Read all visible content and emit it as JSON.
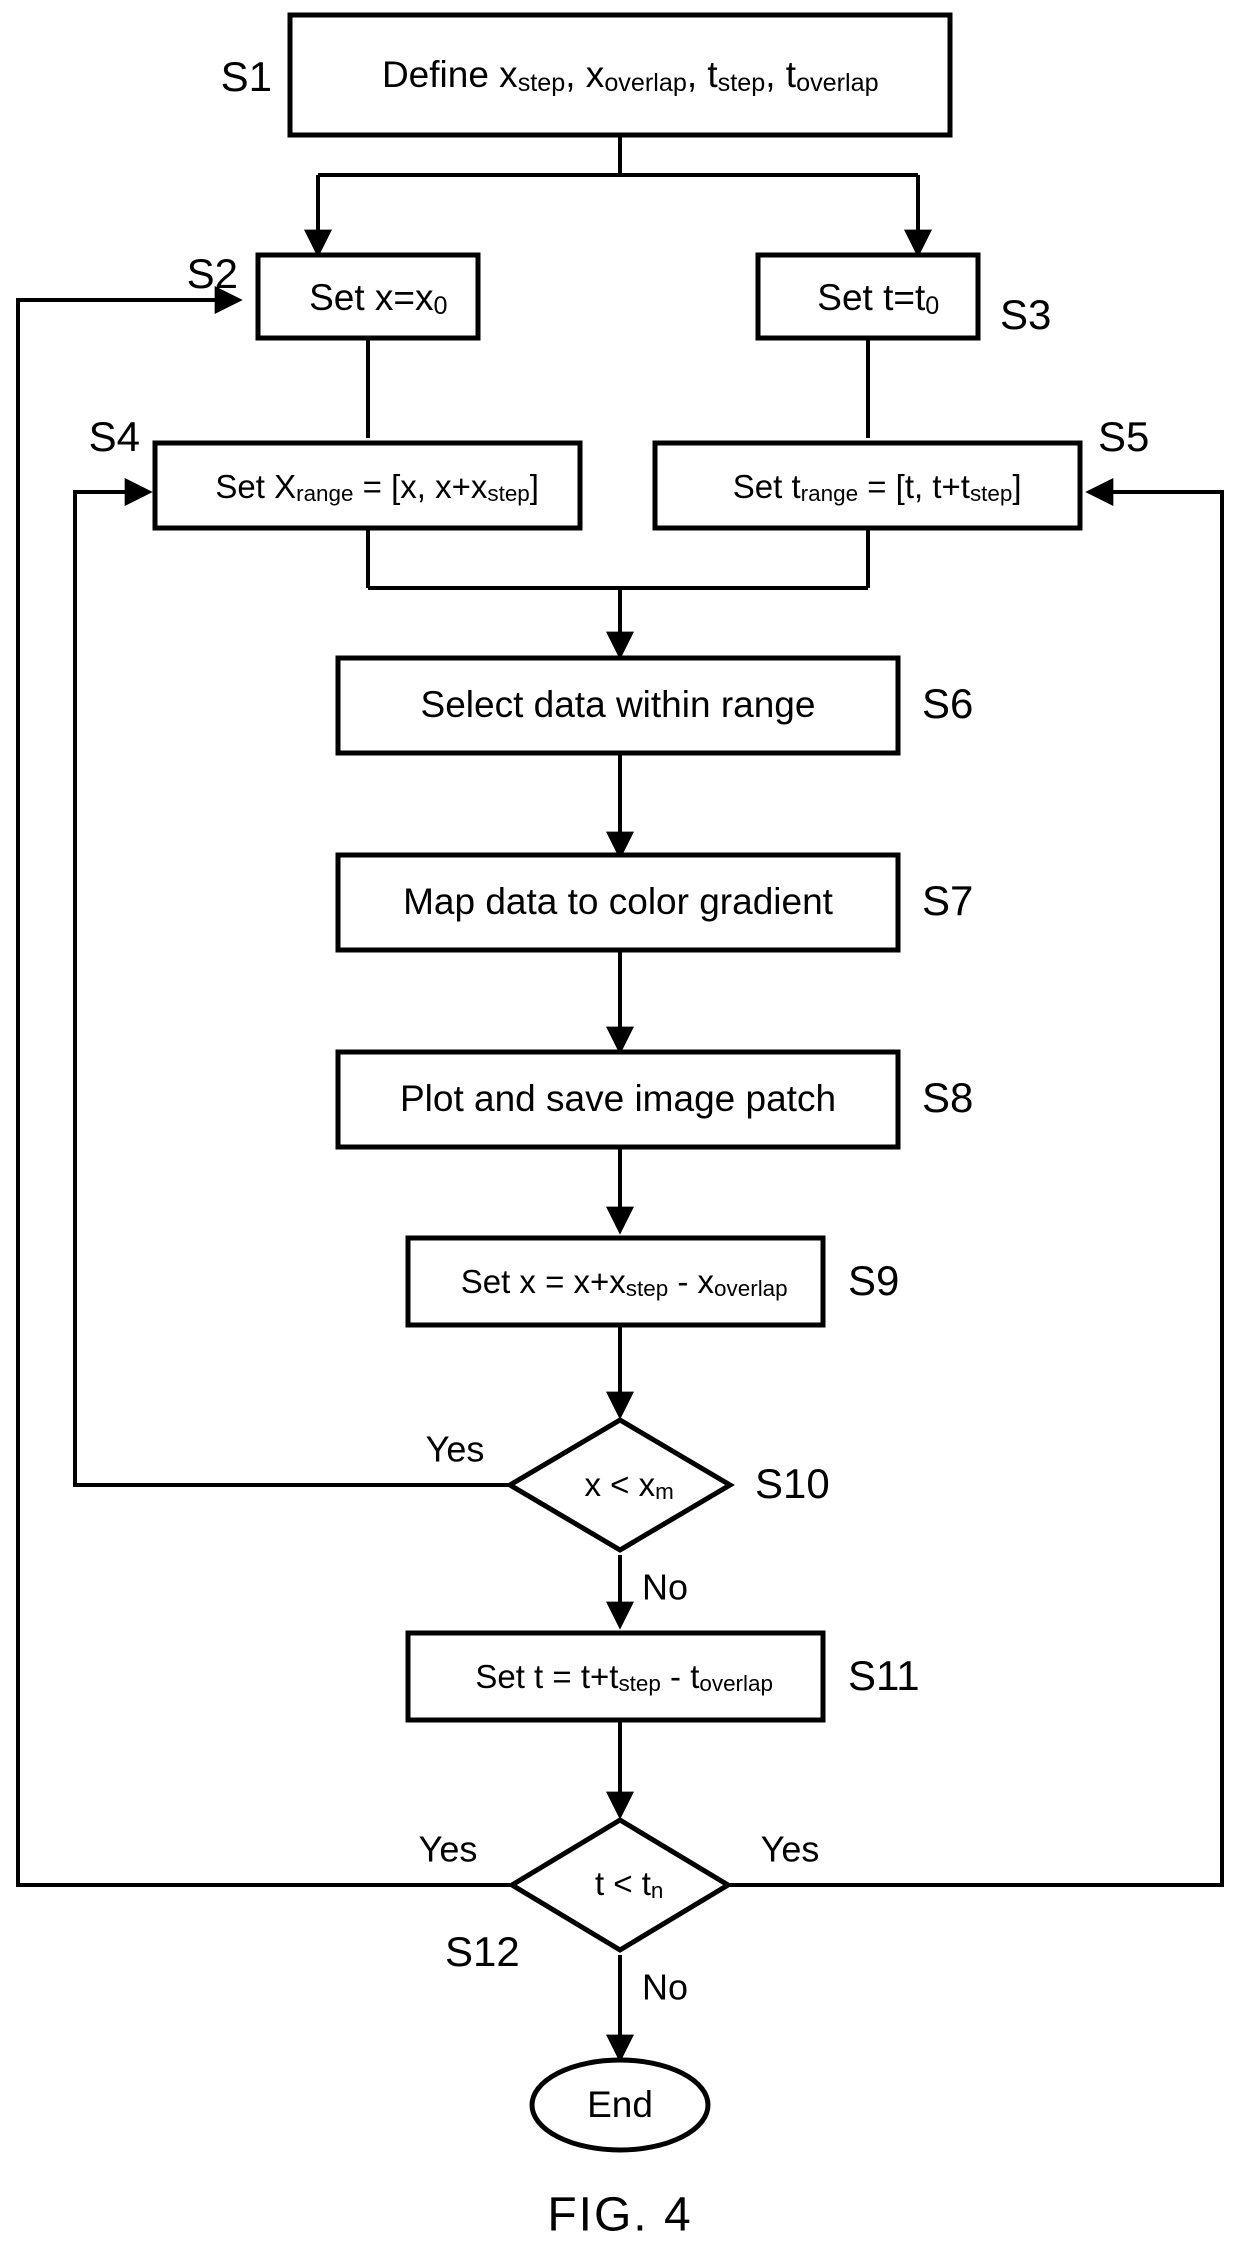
{
  "figure": {
    "caption": "FIG. 4",
    "type": "flowchart"
  },
  "nodes": {
    "s1": {
      "tag": "S1",
      "shape": "process",
      "text_parts": [
        "Define x",
        "step",
        ", x",
        "overlap",
        ", t",
        "step",
        ", t",
        "overlap"
      ],
      "text_plain": "Define x_step, x_overlap, t_step, t_overlap"
    },
    "s2": {
      "tag": "S2",
      "shape": "process",
      "text_parts": [
        "Set x=x",
        "0"
      ],
      "text_plain": "Set x=x_0"
    },
    "s3": {
      "tag": "S3",
      "shape": "process",
      "text_parts": [
        "Set t=t",
        "0"
      ],
      "text_plain": "Set t=t_0"
    },
    "s4": {
      "tag": "S4",
      "shape": "process",
      "text_parts": [
        "Set X",
        "range",
        " = [x, x+x",
        "step",
        "]"
      ],
      "text_plain": "Set X_range = [x, x+x_step]"
    },
    "s5": {
      "tag": "S5",
      "shape": "process",
      "text_parts": [
        "Set t",
        "range",
        " = [t, t+t",
        "step",
        "]"
      ],
      "text_plain": "Set t_range = [t, t+t_step]"
    },
    "s6": {
      "tag": "S6",
      "shape": "process",
      "text_plain": "Select data within range"
    },
    "s7": {
      "tag": "S7",
      "shape": "process",
      "text_plain": "Map data to color gradient"
    },
    "s8": {
      "tag": "S8",
      "shape": "process",
      "text_plain": "Plot and save image patch"
    },
    "s9": {
      "tag": "S9",
      "shape": "process",
      "text_parts": [
        "Set x = x+x",
        "step",
        " - x",
        "overlap"
      ],
      "text_plain": "Set x = x+x_step - x_overlap"
    },
    "s10": {
      "tag": "S10",
      "shape": "decision",
      "text_parts": [
        "x < x",
        "m"
      ],
      "text_plain": "x < x_m",
      "yes_label": "Yes",
      "no_label": "No"
    },
    "s11": {
      "tag": "S11",
      "shape": "process",
      "text_parts": [
        "Set t = t+t",
        "step",
        " - t",
        "overlap"
      ],
      "text_plain": "Set t = t+t_step - t_overlap"
    },
    "s12": {
      "tag": "S12",
      "shape": "decision",
      "text_parts": [
        "t < t",
        "n"
      ],
      "text_plain": "t < t_n",
      "yes_label_left": "Yes",
      "yes_label_right": "Yes",
      "no_label": "No"
    },
    "end": {
      "shape": "terminator",
      "text_plain": "End"
    }
  },
  "colors": {
    "stroke": "#000000",
    "fill": "#ffffff",
    "background": "#ffffff"
  }
}
